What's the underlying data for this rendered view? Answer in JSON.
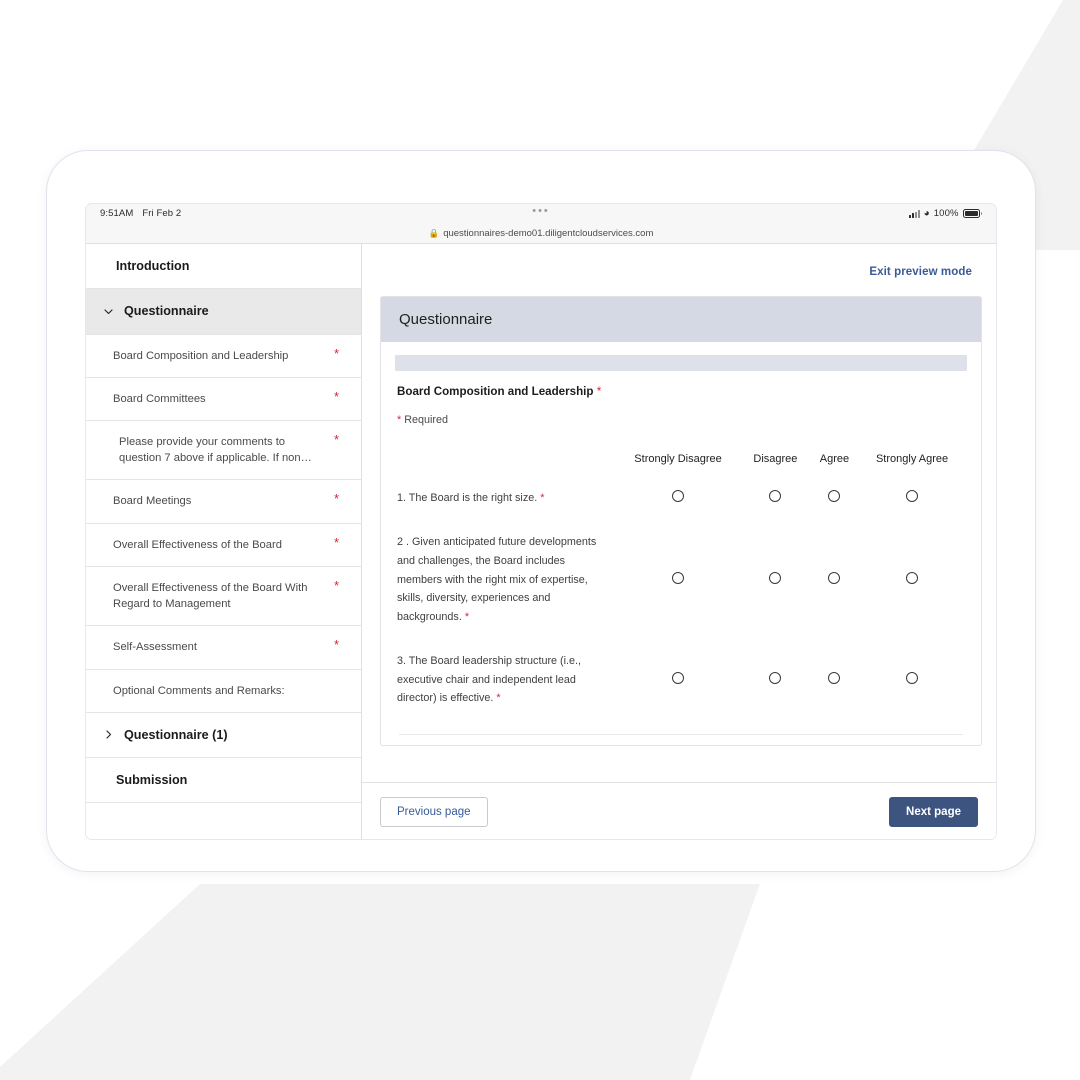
{
  "status_bar": {
    "time": "9:51AM",
    "date": "Fri Feb 2",
    "battery_percent": "100%",
    "dots": "•••"
  },
  "browser": {
    "lock_glyph": "🔒",
    "url": "questionnaires-demo01.diligentcloudservices.com"
  },
  "sidebar": {
    "items": [
      {
        "label": "Introduction",
        "type": "top",
        "required": false
      },
      {
        "label": "Questionnaire",
        "type": "group-open",
        "required": false
      },
      {
        "label": "Board Composition and Leadership",
        "type": "sub",
        "required": true
      },
      {
        "label": "Board Committees",
        "type": "sub",
        "required": true
      },
      {
        "label": "Please provide your comments to question 7 above if applicable. If non…",
        "type": "sub-indent",
        "required": true
      },
      {
        "label": "Board Meetings",
        "type": "sub",
        "required": true
      },
      {
        "label": "Overall Effectiveness of the Board",
        "type": "sub",
        "required": true
      },
      {
        "label": "Overall Effectiveness of the Board With Regard to Management",
        "type": "sub",
        "required": true
      },
      {
        "label": "Self-Assessment",
        "type": "sub",
        "required": true
      },
      {
        "label": "Optional Comments and Remarks:",
        "type": "sub",
        "required": false
      },
      {
        "label": "Questionnaire (1)",
        "type": "group-closed",
        "required": false
      },
      {
        "label": "Submission",
        "type": "top",
        "required": false
      }
    ]
  },
  "content": {
    "exit_preview_label": "Exit preview mode",
    "card_title": "Questionnaire",
    "section_title": "Board Composition and Leadership",
    "section_title_star": "*",
    "required_note_star": "*",
    "required_note": "Required",
    "columns": [
      "Strongly Disagree",
      "Disagree",
      "Agree",
      "Strongly Agree"
    ],
    "questions": [
      {
        "text": "1. The Board is the right size.",
        "star": "*"
      },
      {
        "text": "2 . Given anticipated future developments and challenges, the Board includes members with the right mix of expertise, skills, diversity, experiences and backgrounds.",
        "star": "*"
      },
      {
        "text": "3. The Board leadership structure (i.e., executive chair and independent lead director) is effective.",
        "star": "*"
      }
    ]
  },
  "footer": {
    "previous_label": "Previous page",
    "next_label": "Next page"
  },
  "colors": {
    "accent_link": "#3a5a96",
    "next_button": "#3d5480",
    "card_header": "#d5d9e3",
    "progress": "#dee0ea",
    "required_star": "#d1293d",
    "sidebar_active": "#e9e9e9"
  }
}
